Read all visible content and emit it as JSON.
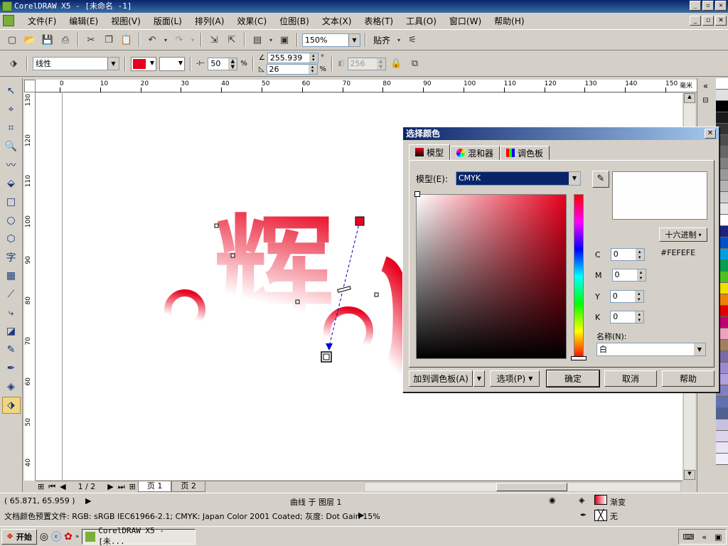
{
  "window": {
    "title": "CorelDRAW X5 - [未命名 -1]"
  },
  "menu": [
    "文件(F)",
    "编辑(E)",
    "视图(V)",
    "版面(L)",
    "排列(A)",
    "效果(C)",
    "位图(B)",
    "文本(X)",
    "表格(T)",
    "工具(O)",
    "窗口(W)",
    "帮助(H)"
  ],
  "toolbar1": {
    "zoom": "150%",
    "snap_label": "贴齐"
  },
  "toolbar2": {
    "fill_type": "线性",
    "fill_color": "#e8001c",
    "midpoint": "50",
    "midpoint_unit": "%",
    "angle": "255.939",
    "angle_unit": "°",
    "edge_pad": "26",
    "edge_pad_unit": "%",
    "steps": "256"
  },
  "ruler": {
    "top_ticks": [
      "0",
      "10",
      "20",
      "30",
      "40",
      "50",
      "60",
      "70",
      "80",
      "90",
      "100",
      "110",
      "120",
      "130",
      "140",
      "150"
    ],
    "top_unit": "毫米",
    "left_ticks": [
      "130",
      "120",
      "110",
      "100",
      "90",
      "80",
      "70",
      "60",
      "50",
      "40"
    ]
  },
  "canvas": {
    "artwork_text": "辉"
  },
  "page_nav": {
    "position": "1 / 2",
    "tabs": [
      "页 1",
      "页 2"
    ]
  },
  "status": {
    "coords": "( 65.871, 65.959 )",
    "selection": "曲线 于 图层 1",
    "fill_label": "渐变",
    "outline_label": "无",
    "color_profile": "文档颜色预置文件: RGB: sRGB IEC61966-2.1; CMYK: Japan Color 2001 Coated; 灰度: Dot Gain 15%"
  },
  "taskbar": {
    "start": "开始",
    "task": "CorelDRAW X5 - [未..."
  },
  "dialog": {
    "title": "选择颜色",
    "tabs": [
      "模型",
      "混和器",
      "调色板"
    ],
    "model_label": "模型(E):",
    "model_value": "CMYK",
    "hex_mode": "十六进制",
    "hex_value": "#FEFEFE",
    "cmyk": [
      {
        "label": "C",
        "value": "0"
      },
      {
        "label": "M",
        "value": "0"
      },
      {
        "label": "Y",
        "value": "0"
      },
      {
        "label": "K",
        "value": "0"
      }
    ],
    "name_label": "名称(N):",
    "name_value": "白",
    "buttons": {
      "add_palette": "加到调色板(A)",
      "options": "选项(P)",
      "ok": "确定",
      "cancel": "取消",
      "help": "帮助"
    }
  },
  "palette_colors": [
    "#ffffff",
    "#e0e0e0",
    "#000000",
    "#1a1a1a",
    "#333333",
    "#4d4d4d",
    "#666666",
    "#808080",
    "#999999",
    "#b3b3b3",
    "#cccccc",
    "#e6e6e6",
    "#ffffff",
    "#1a237e",
    "#0050c8",
    "#00a0e0",
    "#00a050",
    "#50c020",
    "#f0e000",
    "#f08000",
    "#e00000",
    "#c00070",
    "#f0a0c0",
    "#a08060",
    "#7a6aa8",
    "#9a8ad0",
    "#b0a0e0",
    "#8080c0",
    "#6070b0",
    "#506090",
    "#c8c0e0",
    "#dcd4ec",
    "#e8e4f4",
    "#f0eef8"
  ]
}
